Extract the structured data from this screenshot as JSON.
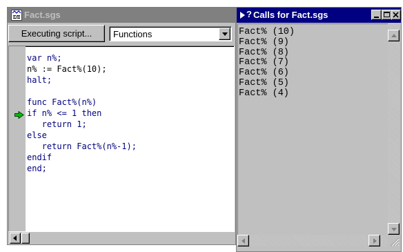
{
  "left_window": {
    "title": "Fact.sgs",
    "status_button": "Executing script...",
    "dropdown_value": "Functions",
    "code_lines": [
      {
        "text": "var n%;",
        "color": "#000080"
      },
      {
        "text": "n% := Fact%(10);",
        "color": "#000000"
      },
      {
        "text": "halt;",
        "color": "#000080"
      },
      {
        "text": "",
        "color": "#000000"
      },
      {
        "text": "func Fact%(n%)",
        "color": "#000080"
      },
      {
        "text": "if n% <= 1 then",
        "color": "#000080",
        "current": true
      },
      {
        "text": "   return 1;",
        "color": "#000080"
      },
      {
        "text": "else",
        "color": "#000080"
      },
      {
        "text": "   return Fact%(n%-1);",
        "color": "#000080"
      },
      {
        "text": "endif",
        "color": "#000080"
      },
      {
        "text": "end;",
        "color": "#000080"
      }
    ]
  },
  "right_window": {
    "title": "Calls for Fact.sgs",
    "calls": [
      "Fact% (10)",
      "Fact% (9)",
      "Fact% (8)",
      "Fact% (7)",
      "Fact% (6)",
      "Fact% (5)",
      "Fact% (4)"
    ]
  },
  "colors": {
    "active_title": "#000080",
    "inactive_title": "#808080",
    "face": "#c0c0c0",
    "current_line_arrow": "#00c000"
  }
}
